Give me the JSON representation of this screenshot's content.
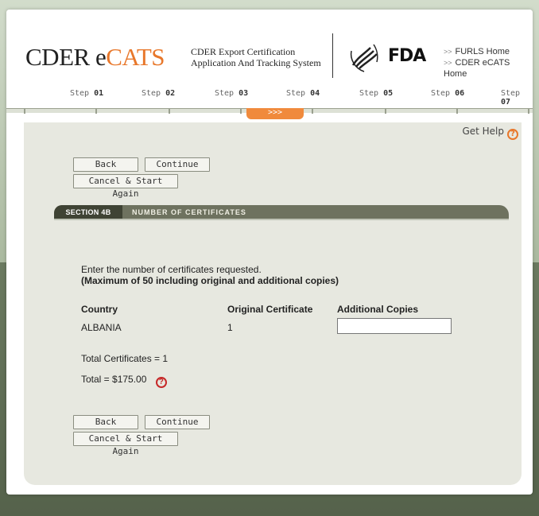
{
  "header": {
    "logo_cder": "CDER ",
    "logo_e": "e",
    "logo_cats": "CATS",
    "tagline_line1": "CDER Export Certification",
    "tagline_line2": "Application And Tracking System",
    "fda_text": "FDA",
    "links": [
      {
        "label": "FURLS Home"
      },
      {
        "label": "CDER eCATS Home"
      }
    ]
  },
  "steps": [
    {
      "prefix": "Step ",
      "num": "01"
    },
    {
      "prefix": "Step ",
      "num": "02"
    },
    {
      "prefix": "Step ",
      "num": "03"
    },
    {
      "prefix": "Step ",
      "num": "04"
    },
    {
      "prefix": "Step ",
      "num": "05"
    },
    {
      "prefix": "Step ",
      "num": "06"
    },
    {
      "prefix": "Step ",
      "num": "07"
    }
  ],
  "current_step_indicator": ">>>",
  "help": {
    "label": "Get Help"
  },
  "buttons": {
    "back": "Back",
    "continue": "Continue",
    "cancel": "Cancel & Start Again"
  },
  "section": {
    "tag": "SECTION 4B",
    "title": "NUMBER OF CERTIFICATES"
  },
  "form": {
    "intro_line1": "Enter the number of certificates requested.",
    "intro_line2": "(Maximum of 50 including original and additional copies)",
    "headers": {
      "country": "Country",
      "original": "Original Certificate",
      "additional": "Additional Copies"
    },
    "row": {
      "country": "ALBANIA",
      "original": "1",
      "additional": ""
    },
    "total_certificates": "Total Certificates = 1",
    "total": "Total = $175.00"
  },
  "colors": {
    "accent": "#e8772a",
    "section_bg": "#6e725f",
    "content_bg": "#e7e8e0"
  }
}
